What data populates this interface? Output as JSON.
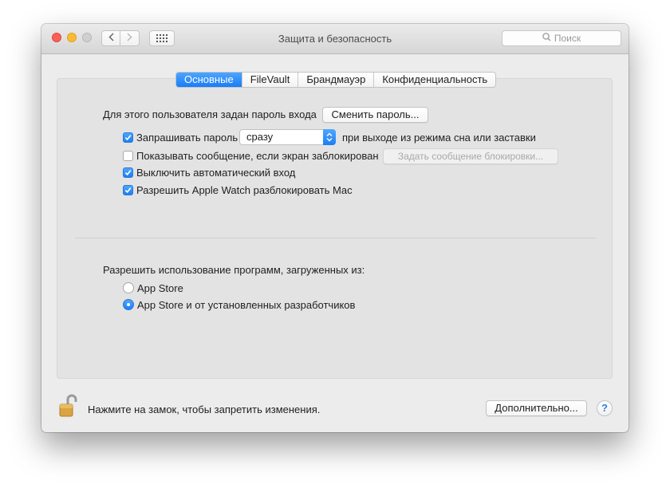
{
  "window": {
    "title": "Защита и безопасность",
    "search_placeholder": "Поиск"
  },
  "tabs": [
    {
      "label": "Основные",
      "active": true
    },
    {
      "label": "FileVault",
      "active": false
    },
    {
      "label": "Брандмауэр",
      "active": false
    },
    {
      "label": "Конфиденциальность",
      "active": false
    }
  ],
  "general": {
    "password_label": "Для этого пользователя задан пароль входа",
    "change_password_button": "Сменить пароль...",
    "require_password": {
      "label": "Запрашивать пароль",
      "checked": true
    },
    "require_password_delay": "сразу",
    "require_password_suffix": "при выходе из режима сна или заставки",
    "show_message": {
      "label": "Показывать сообщение, если экран заблокирован",
      "checked": false
    },
    "set_message_button": "Задать сообщение блокировки...",
    "disable_autologin": {
      "label": "Выключить автоматический вход",
      "checked": true
    },
    "apple_watch_unlock": {
      "label": "Разрешить Apple Watch разблокировать Mac",
      "checked": true
    }
  },
  "apps": {
    "heading": "Разрешить использование программ, загруженных из:",
    "options": [
      {
        "label": "App Store",
        "selected": false
      },
      {
        "label": "App Store и от установленных разработчиков",
        "selected": true
      }
    ]
  },
  "footer": {
    "lock_text": "Нажмите на замок, чтобы запретить изменения.",
    "advanced_button": "Дополнительно...",
    "help_label": "?"
  },
  "colors": {
    "accent": "#1a7cf6",
    "red_light": "#fc5f57",
    "yellow_light": "#fdbb2e",
    "lock_gold": "#d9a441"
  }
}
